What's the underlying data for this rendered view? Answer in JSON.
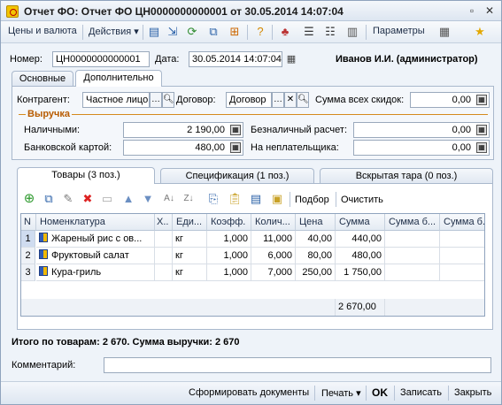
{
  "window": {
    "title": "Отчет ФО: Отчет ФО ЦН0000000000001 от 30.05.2014 14:07:04"
  },
  "toolbar": {
    "prices_label": "Цены и валюта",
    "actions_label": "Действия",
    "params_label": "Параметры"
  },
  "header": {
    "number_label": "Номер:",
    "number_value": "ЦН0000000000001",
    "date_label": "Дата:",
    "date_value": "30.05.2014 14:07:04",
    "user": "Иванов И.И. (администратор)"
  },
  "top_tabs": {
    "main": "Основные",
    "extra": "Дополнительно"
  },
  "extra": {
    "counterparty_label": "Контрагент:",
    "counterparty_value": "Частное лицо",
    "contract_label": "Договор:",
    "contract_value": "Договор",
    "discounts_label": "Сумма всех скидок:",
    "discounts_value": "0,00"
  },
  "revenue": {
    "title": "Выручка",
    "cash_label": "Наличными:",
    "cash_value": "2 190,00",
    "card_label": "Банковской картой:",
    "card_value": "480,00",
    "noncash_label": "Безналичный расчет:",
    "noncash_value": "0,00",
    "nonpayer_label": "На неплательщика:",
    "nonpayer_value": "0,00"
  },
  "tabs": {
    "goods": "Товары (3 поз.)",
    "specs": "Спецификация (1 поз.)",
    "tare": "Вскрытая тара (0 поз.)"
  },
  "goods_toolbar": {
    "select": "Подбор",
    "clear": "Очистить"
  },
  "table": {
    "headers": {
      "n": "N",
      "name": "Номенклатура",
      "x": "Х..",
      "unit": "Еди...",
      "coef": "Коэфф.",
      "qty": "Колич...",
      "price": "Цена",
      "sum": "Сумма",
      "sum_b1": "Сумма б...",
      "sum_b2": "Сумма б..."
    },
    "rows": [
      {
        "n": "1",
        "name": "Жареный рис с ов...",
        "unit": "кг",
        "coef": "1,000",
        "qty": "11,000",
        "price": "40,00",
        "sum": "440,00"
      },
      {
        "n": "2",
        "name": "Фруктовый салат",
        "unit": "кг",
        "coef": "1,000",
        "qty": "6,000",
        "price": "80,00",
        "sum": "480,00"
      },
      {
        "n": "3",
        "name": "Кура-гриль",
        "unit": "кг",
        "coef": "1,000",
        "qty": "7,000",
        "price": "250,00",
        "sum": "1 750,00"
      }
    ],
    "total_sum": "2 670,00"
  },
  "summary": "Итого по товарам: 2 670. Сумма выручки: 2 670",
  "comment": {
    "label": "Комментарий:",
    "value": ""
  },
  "bottom": {
    "generate": "Сформировать документы",
    "print": "Печать",
    "ok": "OK",
    "save": "Записать",
    "close": "Закрыть"
  }
}
